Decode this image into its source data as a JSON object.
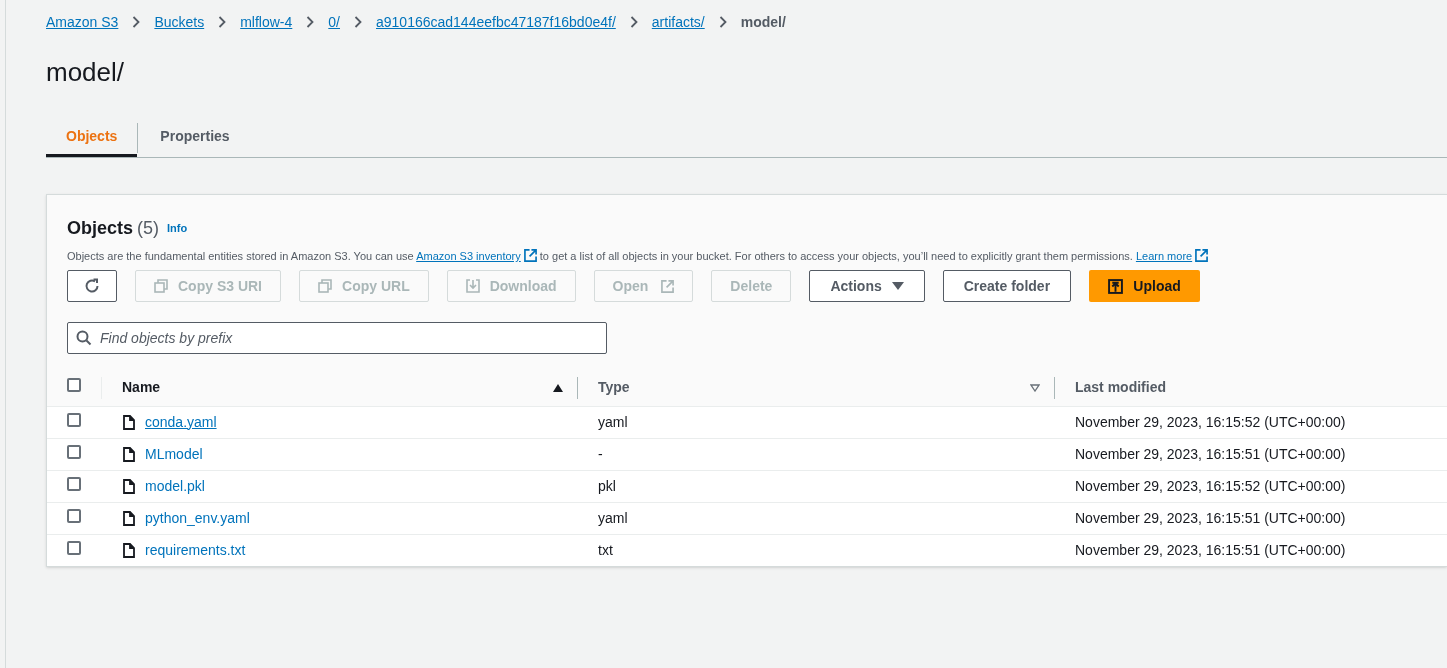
{
  "breadcrumbs": [
    {
      "label": "Amazon S3",
      "link": true
    },
    {
      "label": "Buckets",
      "link": true
    },
    {
      "label": "mlflow-4",
      "link": true
    },
    {
      "label": "0/",
      "link": true
    },
    {
      "label": "a910166cad144eefbc47187f16bd0e4f/",
      "link": true
    },
    {
      "label": "artifacts/",
      "link": true
    },
    {
      "label": "model/",
      "link": false
    }
  ],
  "title": "model/",
  "tabs": [
    {
      "label": "Objects",
      "selected": true
    },
    {
      "label": "Properties",
      "selected": false
    }
  ],
  "panel": {
    "title": "Objects",
    "count": "(5)",
    "info": "Info",
    "description": [
      {
        "kind": "text",
        "text": "Objects are the fundamental entities stored in Amazon S3. You can use "
      },
      {
        "kind": "link",
        "text": "Amazon S3 inventory"
      },
      {
        "kind": "text",
        "text": " to get a list of all objects in your bucket. For others to access your objects, you’ll need to explicitly grant them permissions. "
      },
      {
        "kind": "link",
        "text": "Learn more"
      }
    ],
    "buttons": [
      {
        "kind": "refresh",
        "disabled": false
      },
      {
        "kind": "copy",
        "label": "Copy S3 URI",
        "disabled": true
      },
      {
        "kind": "copy",
        "label": "Copy URL",
        "disabled": true
      },
      {
        "kind": "download",
        "label": "Download",
        "disabled": true
      },
      {
        "kind": "external",
        "label": "Open",
        "disabled": true
      },
      {
        "kind": "plain",
        "label": "Delete",
        "disabled": true
      },
      {
        "kind": "dropdown",
        "label": "Actions",
        "disabled": false
      },
      {
        "kind": "plain",
        "label": "Create folder",
        "disabled": false
      },
      {
        "kind": "primary",
        "label": "Upload",
        "disabled": false
      }
    ],
    "search": {
      "placeholder": "Find objects by prefix"
    }
  },
  "table": {
    "select_all_checked": false,
    "columns": [
      {
        "label": "Name",
        "sortable": true,
        "sorted": true
      },
      {
        "label": "Type",
        "sortable": true,
        "sorted": false
      },
      {
        "label": "Last modified",
        "sortable": false,
        "sorted": false
      }
    ],
    "rows": [
      {
        "name": "conda.yaml",
        "type": "yaml",
        "modified": "November 29, 2023, 16:15:52 (UTC+00:00)",
        "checked": false,
        "hovered": true
      },
      {
        "name": "MLmodel",
        "type": "-",
        "modified": "November 29, 2023, 16:15:51 (UTC+00:00)",
        "checked": false,
        "hovered": false
      },
      {
        "name": "model.pkl",
        "type": "pkl",
        "modified": "November 29, 2023, 16:15:52 (UTC+00:00)",
        "checked": false,
        "hovered": false
      },
      {
        "name": "python_env.yaml",
        "type": "yaml",
        "modified": "November 29, 2023, 16:15:51 (UTC+00:00)",
        "checked": false,
        "hovered": false
      },
      {
        "name": "requirements.txt",
        "type": "txt",
        "modified": "November 29, 2023, 16:15:51 (UTC+00:00)",
        "checked": false,
        "hovered": false
      }
    ]
  }
}
